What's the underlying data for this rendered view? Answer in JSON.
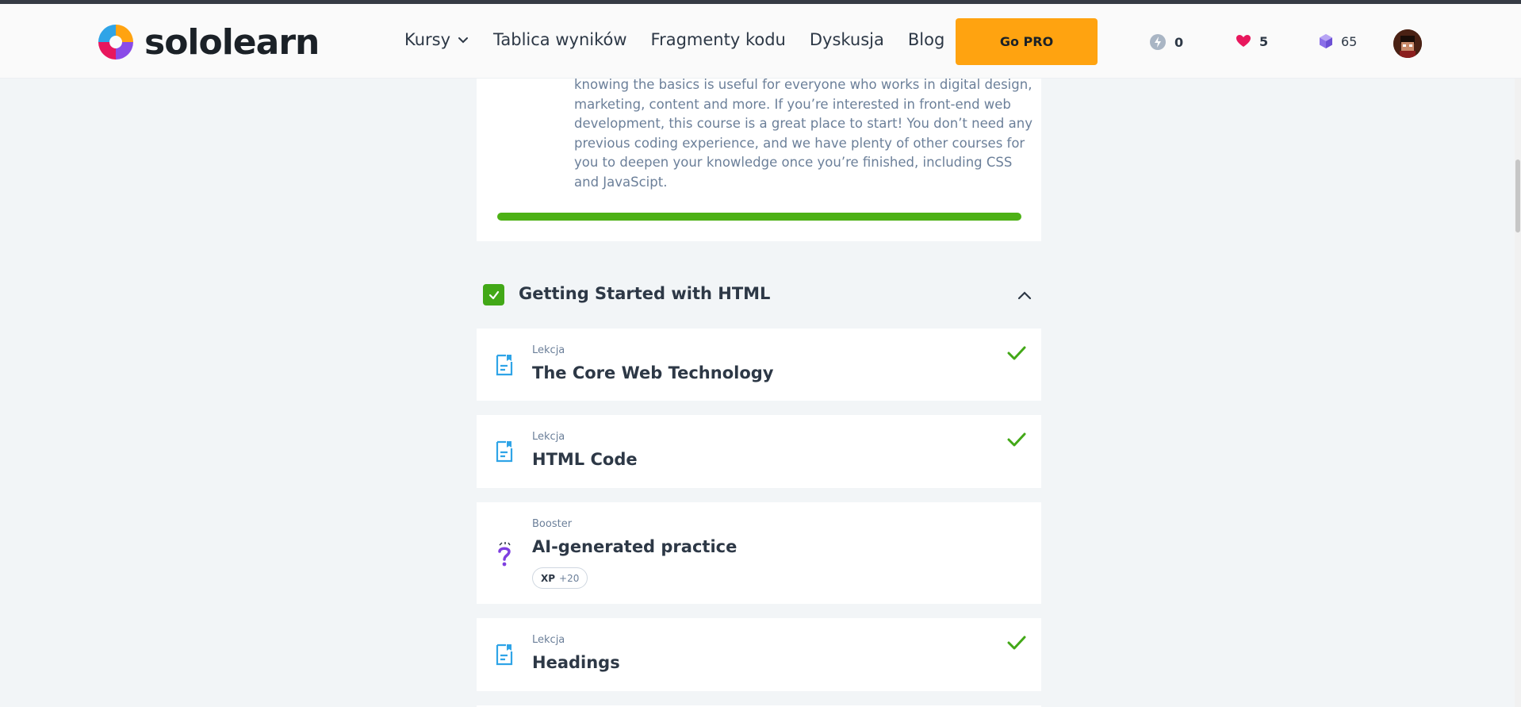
{
  "header": {
    "logo_text": "sololearn",
    "nav": [
      {
        "label": "Kursy",
        "has_dropdown": true
      },
      {
        "label": "Tablica wyników"
      },
      {
        "label": "Fragmenty kodu"
      },
      {
        "label": "Dyskusja"
      },
      {
        "label": "Blog"
      }
    ],
    "go_pro_label": "Go PRO",
    "stats": {
      "streak": "0",
      "hearts": "5",
      "gems": "65"
    },
    "colors": {
      "accent": "#ffa310",
      "heart": "#e8175d",
      "gem": "#8a6fe8",
      "streak": "#a9b5c4"
    }
  },
  "course": {
    "description": "knowing the basics is useful for everyone who works in digital design, marketing, content and more. If you’re interested in front-end web development, this course is a great place to start! You don’t need any previous coding experience, and we have plenty of other courses for you to deepen your knowledge once you’re finished, including CSS and JavaScipt.",
    "progress_percent": 100,
    "progress_color": "#4db115"
  },
  "section": {
    "title": "Getting Started with HTML",
    "completed": true,
    "expanded": true
  },
  "lessons": [
    {
      "type": "Lekcja",
      "title": "The Core Web Technology",
      "icon": "lesson-doc-icon",
      "completed": true
    },
    {
      "type": "Lekcja",
      "title": "HTML Code",
      "icon": "lesson-doc-icon",
      "completed": true
    },
    {
      "type": "Booster",
      "title": "AI-generated practice",
      "icon": "question-mark-icon",
      "completed": false,
      "xp_label": "XP",
      "xp_value": "+20"
    },
    {
      "type": "Lekcja",
      "title": "Headings",
      "icon": "lesson-doc-icon",
      "completed": true
    }
  ]
}
